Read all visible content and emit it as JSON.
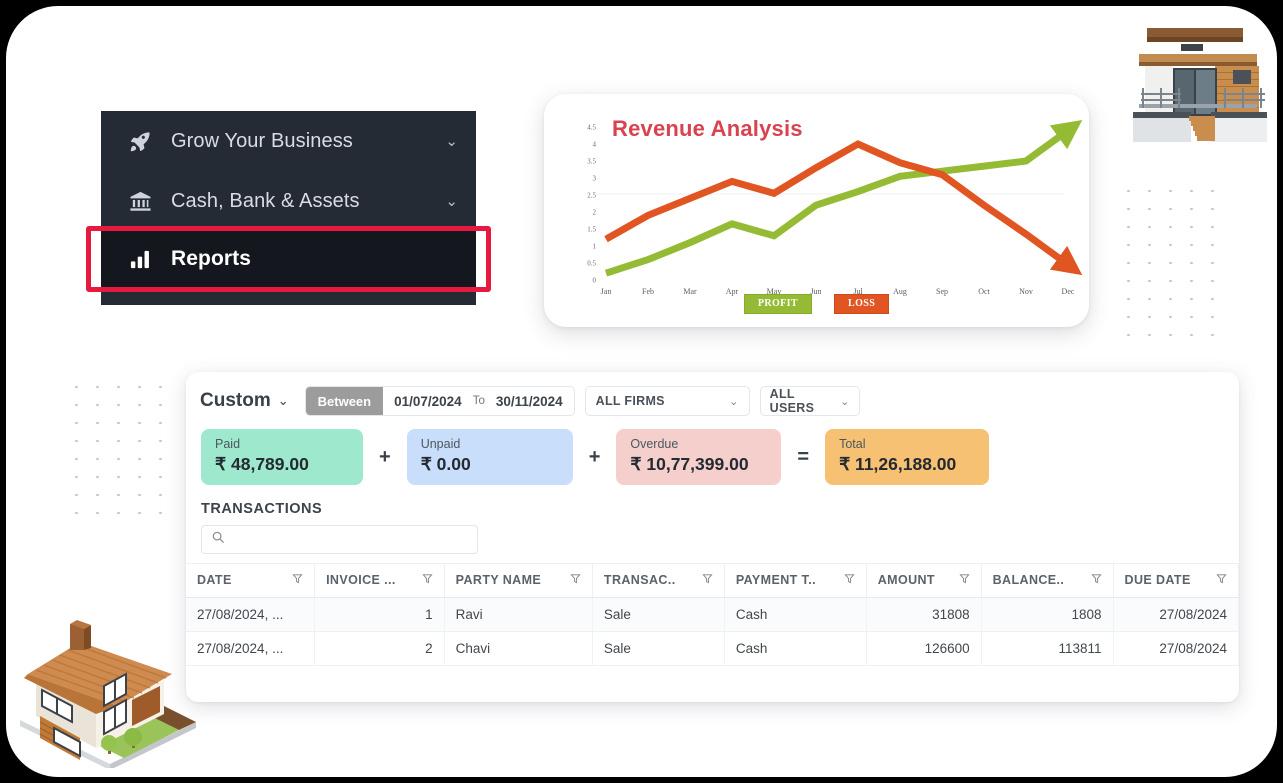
{
  "sidebar": {
    "items": [
      {
        "label": "Grow Your Business",
        "icon": "rocket-icon",
        "chevron": "⌄"
      },
      {
        "label": "Cash, Bank & Assets",
        "icon": "bank-icon",
        "chevron": "⌄"
      },
      {
        "label": "Reports",
        "icon": "bar-chart-icon",
        "active": true
      }
    ],
    "highlight_color": "#e8193f",
    "background": "#242b35",
    "active_background": "#14181e"
  },
  "chart_data": {
    "type": "line",
    "title": "Revenue Analysis",
    "title_color": "#d9434f",
    "xlabel": "",
    "ylabel": "",
    "categories": [
      "Jan",
      "Feb",
      "Mar",
      "Apr",
      "May",
      "Jun",
      "Jul",
      "Aug",
      "Sep",
      "Oct",
      "Nov",
      "Dec"
    ],
    "yticks": [
      "0",
      "0.5",
      "1",
      "1.5",
      "2",
      "2.5",
      "3",
      "3.5",
      "4",
      "4.5"
    ],
    "ylim": [
      0,
      4.5
    ],
    "grid": false,
    "legend_position": "bottom",
    "series": [
      {
        "name": "PROFIT",
        "color": "#95bb35",
        "values": [
          0.2,
          0.6,
          1.1,
          1.65,
          1.3,
          2.2,
          2.6,
          3.05,
          3.2,
          3.35,
          3.5,
          4.4
        ]
      },
      {
        "name": "LOSS",
        "color": "#e15523",
        "values": [
          1.2,
          1.9,
          2.4,
          2.9,
          2.55,
          3.3,
          4.0,
          3.45,
          3.1,
          2.2,
          1.35,
          0.45
        ]
      }
    ],
    "legend": [
      {
        "label": "PROFIT",
        "color": "#95bb35"
      },
      {
        "label": "LOSS",
        "color": "#e15523"
      }
    ]
  },
  "report": {
    "filters": {
      "range_preset": "Custom",
      "range_preset_chevron": "⌄",
      "between_label": "Between",
      "date_from": "01/07/2024",
      "to_label": "To",
      "date_to": "30/11/2024",
      "firms_value": "ALL FIRMS",
      "users_value": "ALL USERS",
      "chevron": "⌄"
    },
    "summary": [
      {
        "key": "Paid",
        "value": "₹ 48,789.00",
        "color": "#9ee8cd"
      },
      {
        "op": "+"
      },
      {
        "key": "Unpaid",
        "value": "₹ 0.00",
        "color": "#c9defb"
      },
      {
        "op": "+"
      },
      {
        "key": "Overdue",
        "value": "₹ 10,77,399.00",
        "color": "#f4cfcb"
      },
      {
        "op": "="
      },
      {
        "key": "Total",
        "value": "₹ 11,26,188.00",
        "color": "#f7c173"
      }
    ],
    "summary_items": {
      "paid_key": "Paid",
      "paid_value": "₹ 48,789.00",
      "unpaid_key": "Unpaid",
      "unpaid_value": "₹ 0.00",
      "overdue_key": "Overdue",
      "overdue_value": "₹ 10,77,399.00",
      "total_key": "Total",
      "total_value": "₹ 11,26,188.00",
      "op_plus_1": "+",
      "op_plus_2": "+",
      "op_equals": "="
    },
    "transactions_title": "TRANSACTIONS",
    "search_placeholder": "",
    "search_value": "",
    "table": {
      "columns": [
        {
          "label": "DATE",
          "filter": true,
          "align": "left"
        },
        {
          "label": "INVOICE ...",
          "filter": true,
          "align": "right"
        },
        {
          "label": "PARTY NAME",
          "filter": true,
          "align": "left"
        },
        {
          "label": "TRANSAC..",
          "filter": true,
          "align": "left"
        },
        {
          "label": "PAYMENT T..",
          "filter": true,
          "align": "left"
        },
        {
          "label": "AMOUNT",
          "filter": true,
          "align": "right"
        },
        {
          "label": "BALANCE..",
          "filter": true,
          "align": "right"
        },
        {
          "label": "DUE DATE",
          "filter": true,
          "align": "right"
        }
      ],
      "column_labels": {
        "c0": "DATE",
        "c1": "INVOICE ...",
        "c2": "PARTY NAME",
        "c3": "TRANSAC..",
        "c4": "PAYMENT T..",
        "c5": "AMOUNT",
        "c6": "BALANCE..",
        "c7": "DUE DATE"
      },
      "rows": [
        {
          "date": "27/08/2024, ...",
          "invoice": "1",
          "party": "Ravi",
          "transaction": "Sale",
          "payment": "Cash",
          "amount": "31808",
          "balance": "1808",
          "due_date": "27/08/2024"
        },
        {
          "date": "27/08/2024, ...",
          "invoice": "2",
          "party": "Chavi",
          "transaction": "Sale",
          "payment": "Cash",
          "amount": "126600",
          "balance": "113811",
          "due_date": "27/08/2024"
        }
      ]
    }
  },
  "decor": {
    "modern_house": "modern-house-illustration",
    "iso_house": "isometric-house-illustration",
    "dot_grid": "dot-grid-pattern"
  }
}
